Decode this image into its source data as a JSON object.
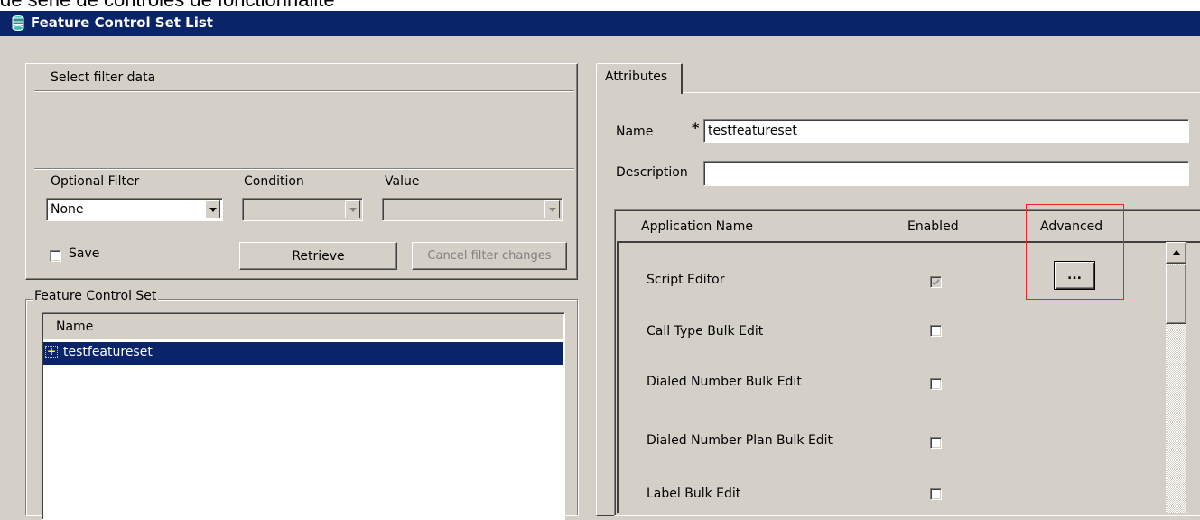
{
  "top_caption": "de série de contrôles de fonctionnalité",
  "window": {
    "title": "Feature Control Set List",
    "icon": "app-window-icon"
  },
  "filter": {
    "header": "Select filter data",
    "optional_filter_label": "Optional Filter",
    "condition_label": "Condition",
    "value_label": "Value",
    "optional_filter_value": "None",
    "condition_value": "",
    "value_value": "",
    "save_label": "Save",
    "save_checked": false,
    "retrieve_label": "Retrieve",
    "cancel_label": "Cancel filter changes"
  },
  "feature_control_set": {
    "legend": "Feature Control Set",
    "column_name": "Name",
    "rows": [
      {
        "name": "testfeatureset",
        "expand_icon": "plus-icon",
        "selected": true
      }
    ]
  },
  "attributes": {
    "tab_label": "Attributes",
    "name_label": "Name",
    "required_marker": "*",
    "name_value": "testfeatureset",
    "description_label": "Description",
    "description_value": "",
    "table": {
      "col_application": "Application Name",
      "col_enabled": "Enabled",
      "col_advanced": "Advanced",
      "advanced_button_label": "...",
      "rows": [
        {
          "name": "Script Editor",
          "enabled": true,
          "enabled_disabled": true,
          "has_advanced": true
        },
        {
          "name": "Call Type Bulk Edit",
          "enabled": false,
          "enabled_disabled": false,
          "has_advanced": false
        },
        {
          "name": "Dialed Number Bulk Edit",
          "enabled": false,
          "enabled_disabled": false,
          "has_advanced": false
        },
        {
          "name": "Dialed Number Plan Bulk Edit",
          "enabled": false,
          "enabled_disabled": false,
          "has_advanced": false
        },
        {
          "name": "Label Bulk Edit",
          "enabled": false,
          "enabled_disabled": false,
          "has_advanced": false
        }
      ]
    }
  },
  "colors": {
    "titlebar": "#0a246a",
    "face": "#d4d0c8",
    "selection": "#0a246a",
    "highlight_box": "#e8262c"
  }
}
